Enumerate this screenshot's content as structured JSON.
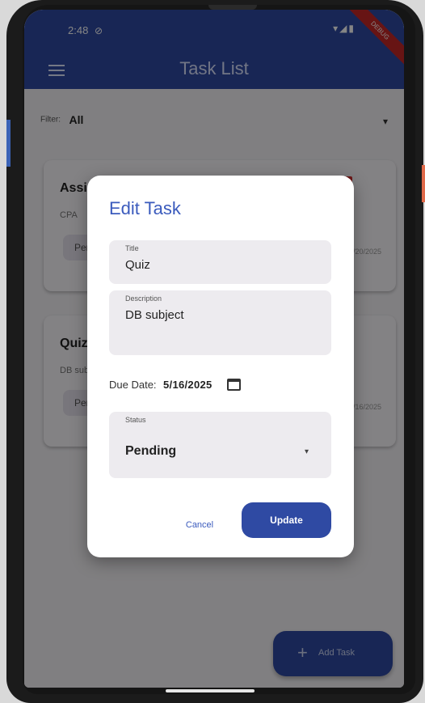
{
  "status_bar": {
    "time": "2:48",
    "dnd_icon": "⊘",
    "icons": "▾◢▮"
  },
  "app_bar": {
    "title": "Task List",
    "menu_icon": "hamburger-menu-icon"
  },
  "debug_banner": "DEBUG",
  "filter": {
    "label": "Filter:",
    "value": "All",
    "caret": "▾"
  },
  "cards": [
    {
      "title": "Assignment",
      "description": "CPA",
      "status": "Pending",
      "due": "5/20/2025"
    },
    {
      "title": "Quiz",
      "description": "DB subject",
      "status": "Pending",
      "due": "5/16/2025"
    }
  ],
  "dialog": {
    "title": "Edit Task",
    "title_field": {
      "label": "Title",
      "value": "Quiz"
    },
    "description_field": {
      "label": "Description",
      "value": "DB subject"
    },
    "due_date": {
      "label": "Due Date:",
      "value": "5/16/2025"
    },
    "status_field": {
      "label": "Status",
      "value": "Pending",
      "caret": "▾"
    },
    "cancel_label": "Cancel",
    "update_label": "Update"
  },
  "fab": {
    "icon": "+",
    "label": "Add Task"
  },
  "colors": {
    "primary": "#2f4aa3",
    "accent_text": "#3b5bbd",
    "delete": "#d32f2f"
  }
}
